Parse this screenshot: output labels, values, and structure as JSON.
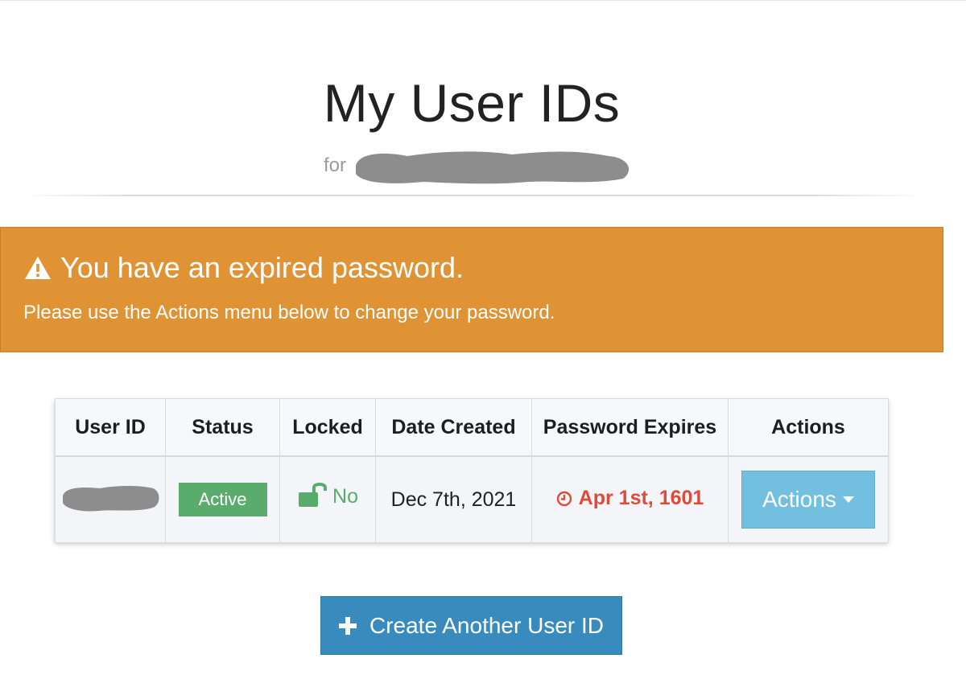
{
  "header": {
    "title": "My User IDs",
    "subtitle_prefix": "for"
  },
  "alert": {
    "icon": "warning-triangle-icon",
    "heading": "You have an expired password.",
    "message": "Please use the Actions menu below to change your password.",
    "color": "#df9335"
  },
  "table": {
    "columns": [
      "User ID",
      "Status",
      "Locked",
      "Date Created",
      "Password Expires",
      "Actions"
    ],
    "rows": [
      {
        "status": "Active",
        "locked": "No",
        "date_created": "Dec 7th, 2021",
        "password_expires": "Apr 1st, 1601",
        "actions_label": "Actions"
      }
    ]
  },
  "create_button": {
    "icon": "plus-icon",
    "label": "Create Another User ID"
  },
  "colors": {
    "success": "#5aac6c",
    "danger": "#dd4b39",
    "info": "#73bfdf",
    "primary": "#3a8bbd"
  }
}
